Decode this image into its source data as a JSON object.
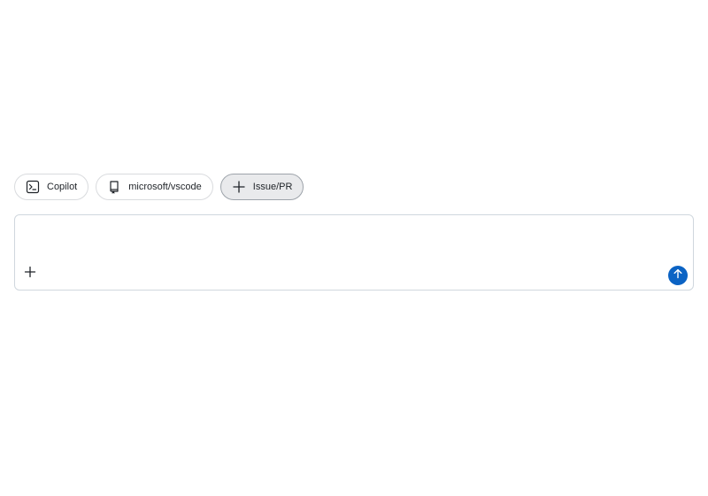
{
  "chips": [
    {
      "label": "Copilot",
      "icon": "terminal-icon",
      "selected": false
    },
    {
      "label": "microsoft/vscode",
      "icon": "repo-icon",
      "selected": false
    },
    {
      "label": "Issue/PR",
      "icon": "plus-icon",
      "selected": true
    }
  ],
  "composer": {
    "value": "",
    "placeholder": "",
    "add_icon": "plus-icon",
    "send_icon": "arrow-up-icon"
  },
  "colors": {
    "accent": "#0b63c4",
    "chip_border": "#d9dbde",
    "chip_selected_bg": "#e9eaec",
    "text": "#1f2328"
  }
}
